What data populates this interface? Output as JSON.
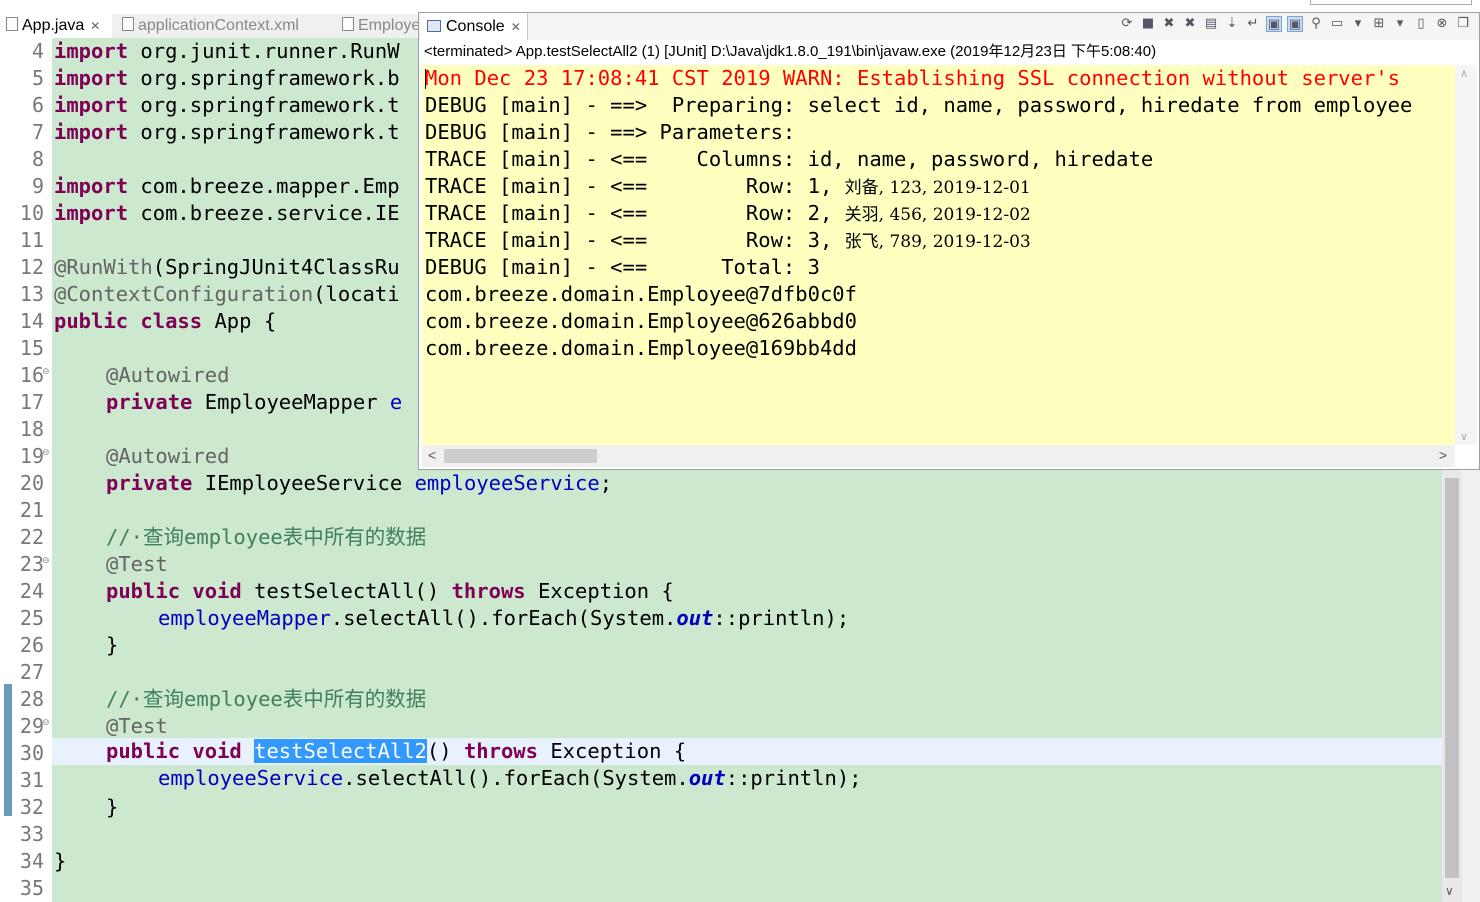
{
  "editor": {
    "tabs": [
      {
        "label": "App.java",
        "active": true
      },
      {
        "label": "applicationContext.xml",
        "active": false
      },
      {
        "label": "Employe",
        "active": false
      }
    ],
    "line_numbers": [
      "4",
      "5",
      "6",
      "7",
      "8",
      "9",
      "10",
      "11",
      "12",
      "13",
      "14",
      "15",
      "16",
      "17",
      "18",
      "19",
      "20",
      "21",
      "22",
      "23",
      "24",
      "25",
      "26",
      "27",
      "28",
      "29",
      "30",
      "31",
      "32",
      "33",
      "34",
      "35"
    ],
    "lines": {
      "l4_kw": "import",
      "l4_rest": " org.junit.runner.RunW",
      "l5_kw": "import",
      "l5_rest": " org.springframework.b",
      "l6_kw": "import",
      "l6_rest": " org.springframework.t",
      "l7_kw": "import",
      "l7_rest": " org.springframework.t",
      "l9_kw": "import",
      "l9_rest": " com.breeze.mapper.Emp",
      "l10_kw": "import",
      "l10_rest": " com.breeze.service.IE",
      "l12_an": "@RunWith",
      "l12_rest": "(SpringJUnit4ClassRu",
      "l13_an": "@ContextConfiguration",
      "l13_rest": "(locati",
      "l14_kw": "public class",
      "l14_rest": " App {",
      "l16_an": "@Autowired",
      "l17_kw": "private",
      "l17_rest": " EmployeeMapper ",
      "l17_fl": "e",
      "l19_an": "@Autowired",
      "l20_kw": "private",
      "l20_rest": " IEmployeeService ",
      "l20_fl": "employeeService",
      "l20_end": ";",
      "l22_cm": "//·查询employee表中所有的数据",
      "l23_an": "@Test",
      "l24_kw": "public void",
      "l24_mid": " testSelectAll() ",
      "l24_kw2": "throws",
      "l24_end": " Exception {",
      "l25_fl": "employeeMapper",
      "l25_mid": ".selectAll().forEach(System.",
      "l25_it": "out",
      "l25_end": "::println);",
      "l26": "}",
      "l28_cm": "//·查询employee表中所有的数据",
      "l29_an": "@Test",
      "l30_kw": "public void",
      "l30_sel": "testSelectAll2",
      "l30_mid": "() ",
      "l30_kw2": "throws",
      "l30_end": " Exception {",
      "l31_fl": "employeeService",
      "l31_mid": ".selectAll().forEach(System.",
      "l31_it": "out",
      "l31_end": "::println);",
      "l32": "}",
      "l34": "}"
    }
  },
  "console": {
    "tab_label": "Console",
    "status": "<terminated> App.testSelectAll2 (1) [JUnit] D:\\Java\\jdk1.8.0_191\\bin\\javaw.exe (2019年12月23日 下午5:08:40)",
    "output": {
      "warn": "Mon Dec 23 17:08:41 CST 2019 WARN: Establishing SSL connection without server's",
      "o2": "DEBUG [main] - ==>  Preparing: select id, name, password, hiredate from employee",
      "o3": "DEBUG [main] - ==> Parameters: ",
      "o4": "TRACE [main] - <==    Columns: id, name, password, hiredate",
      "o5_pre": "TRACE [main] - <==        Row: 1, ",
      "o5_data": "刘备, 123, 2019-12-01",
      "o6_pre": "TRACE [main] - <==        Row: 2, ",
      "o6_data": "关羽, 456, 2019-12-02",
      "o7_pre": "TRACE [main] - <==        Row: 3, ",
      "o7_data": "张飞, 789, 2019-12-03",
      "o8": "DEBUG [main] - <==      Total: 3",
      "o9": "com.breeze.domain.Employee@7dfb0c0f",
      "o10": "com.breeze.domain.Employee@626abbd0",
      "o11": "com.breeze.domain.Employee@169bb4dd"
    },
    "toolbar_icons": [
      "sync-icon",
      "terminate-icon",
      "remove-launch-icon",
      "remove-all-icon",
      "clear-console-icon",
      "scroll-lock-icon",
      "word-wrap-icon",
      "show-on-stdout-icon",
      "show-on-stderr-icon",
      "pin-console-icon",
      "display-console-icon",
      "display-dropdown-icon",
      "open-console-icon",
      "open-dropdown-icon",
      "minimize-icon",
      "maximize-icon",
      "restore-icon"
    ]
  },
  "colors": {
    "editor_bg": "#cce8cf",
    "console_bg": "#ffffc0",
    "keyword": "#7f0055",
    "annotation": "#646464",
    "field": "#0000c0",
    "comment": "#3f7f5f",
    "warn": "#ff0000",
    "selection": "#3399ff"
  }
}
